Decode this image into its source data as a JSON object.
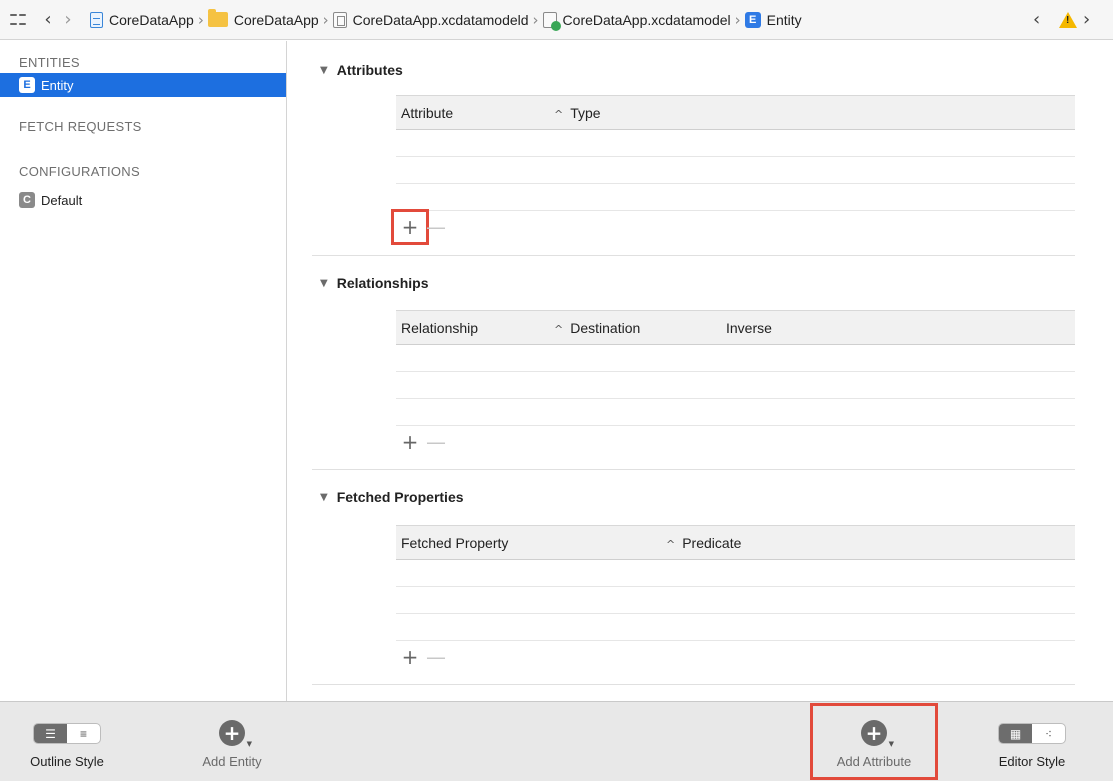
{
  "jumpbar": {
    "breadcrumbs": [
      {
        "label": "CoreDataApp",
        "icon": "project-file-icon"
      },
      {
        "label": "CoreDataApp",
        "icon": "folder-icon"
      },
      {
        "label": "CoreDataApp.xcdatamodeld",
        "icon": "data-model-bundle-icon"
      },
      {
        "label": "CoreDataApp.xcdatamodel",
        "icon": "data-model-file-icon"
      },
      {
        "label": "Entity",
        "icon": "entity-icon"
      }
    ],
    "entity_badge": "E",
    "warning_glyph": "!"
  },
  "sidebar": {
    "entities_heading": "ENTITIES",
    "entity_item": {
      "badge": "E",
      "label": "Entity"
    },
    "fetch_requests_heading": "FETCH REQUESTS",
    "configurations_heading": "CONFIGURATIONS",
    "configuration_item": {
      "badge": "C",
      "label": "Default"
    }
  },
  "main": {
    "attributes": {
      "title": "Attributes",
      "columns": [
        "Attribute",
        "Type"
      ]
    },
    "relationships": {
      "title": "Relationships",
      "columns": [
        "Relationship",
        "Destination",
        "Inverse"
      ]
    },
    "fetched_properties": {
      "title": "Fetched Properties",
      "columns": [
        "Fetched Property",
        "Predicate"
      ]
    },
    "add_symbol": "+",
    "remove_symbol": "—"
  },
  "bottombar": {
    "outline_style_label": "Outline Style",
    "add_entity_label": "Add Entity",
    "add_attribute_label": "Add Attribute",
    "editor_style_label": "Editor Style"
  },
  "colors": {
    "selection": "#1d6fe0",
    "highlight": "#e24a3b",
    "warning": "#f5b800"
  }
}
